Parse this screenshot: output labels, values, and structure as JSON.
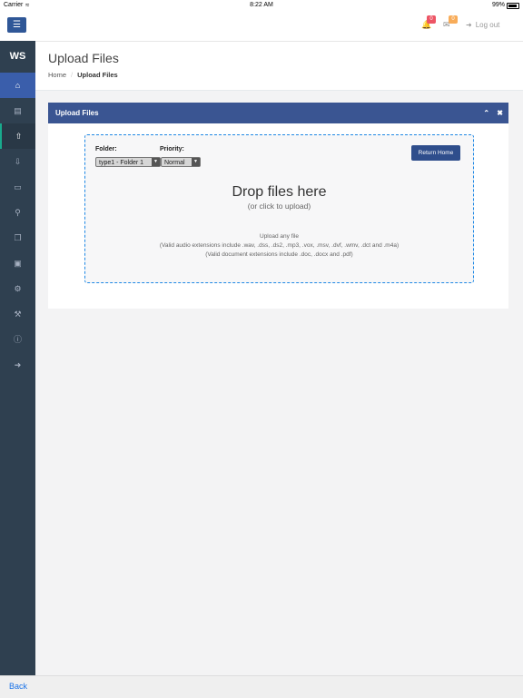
{
  "status_bar": {
    "carrier": "Carrier",
    "time": "8:22 AM",
    "battery": "99%"
  },
  "topnav": {
    "menu_icon": "hamburger-icon",
    "notifications": [
      {
        "icon": "bell-icon",
        "count": "0",
        "color": "#ed5565"
      },
      {
        "icon": "envelope-icon",
        "count": "0",
        "color": "#f8ac59"
      }
    ],
    "logout_label": "Log out"
  },
  "sidebar": {
    "brand": "WS",
    "items": [
      {
        "icon": "home-icon"
      },
      {
        "icon": "file-icon"
      },
      {
        "icon": "upload-icon"
      },
      {
        "icon": "download-icon"
      },
      {
        "icon": "document-icon"
      },
      {
        "icon": "search-icon"
      },
      {
        "icon": "copy-icon"
      },
      {
        "icon": "money-icon"
      },
      {
        "icon": "gear-icon"
      },
      {
        "icon": "wrench-icon"
      },
      {
        "icon": "info-icon"
      },
      {
        "icon": "sign-out-icon"
      }
    ]
  },
  "page": {
    "title": "Upload Files",
    "breadcrumb": [
      "Home",
      "Upload Files"
    ]
  },
  "panel": {
    "title": "Upload Files",
    "folder_label": "Folder:",
    "folder_value": "type1 - Folder 1",
    "priority_label": "Priority:",
    "priority_value": "Normal",
    "return_button": "Return Home",
    "drop_title": "Drop files here",
    "drop_subtitle": "(or click to upload)",
    "info": [
      "Upload any file",
      "(Valid audio extensions include .wav, .dss, .ds2, .mp3, .vox, .msv, .dvf, .wmv, .dct and .m4a)",
      "(Valid document extensions include .doc, .docx and .pdf)"
    ]
  },
  "backbar": {
    "label": "Back"
  }
}
